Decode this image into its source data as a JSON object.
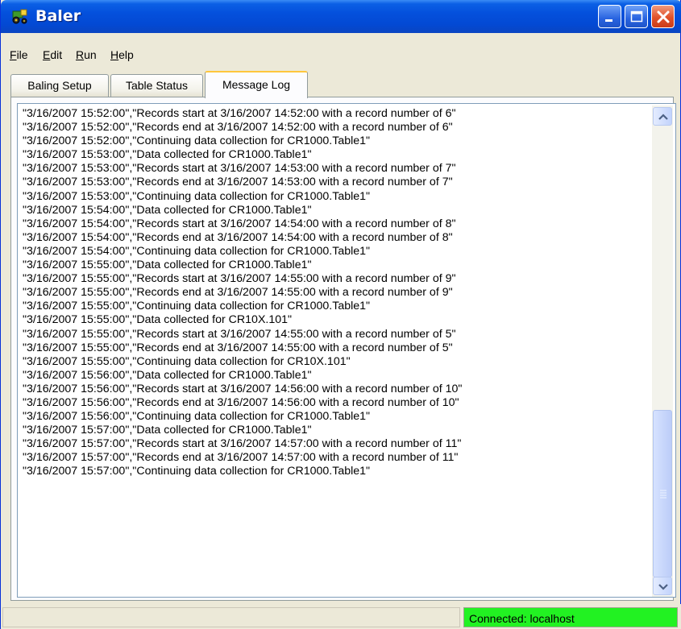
{
  "window": {
    "title": "Baler"
  },
  "menu": [
    {
      "label": "File",
      "mnemonic": "F",
      "rest": "ile"
    },
    {
      "label": "Edit",
      "mnemonic": "E",
      "rest": "dit"
    },
    {
      "label": "Run",
      "mnemonic": "R",
      "rest": "un"
    },
    {
      "label": "Help",
      "mnemonic": "H",
      "rest": "elp"
    }
  ],
  "tabs": [
    {
      "label": "Baling Setup",
      "active": false
    },
    {
      "label": "Table Status",
      "active": false
    },
    {
      "label": "Message Log",
      "active": true
    }
  ],
  "log": [
    "\"3/16/2007 15:52:00\",\"Records start at 3/16/2007 14:52:00 with a record number of 6\"",
    "\"3/16/2007 15:52:00\",\"Records end at 3/16/2007 14:52:00 with a record number of 6\"",
    "\"3/16/2007 15:52:00\",\"Continuing data collection for CR1000.Table1\"",
    "\"3/16/2007 15:53:00\",\"Data collected for CR1000.Table1\"",
    "\"3/16/2007 15:53:00\",\"Records start at 3/16/2007 14:53:00 with a record number of 7\"",
    "\"3/16/2007 15:53:00\",\"Records end at 3/16/2007 14:53:00 with a record number of 7\"",
    "\"3/16/2007 15:53:00\",\"Continuing data collection for CR1000.Table1\"",
    "\"3/16/2007 15:54:00\",\"Data collected for CR1000.Table1\"",
    "\"3/16/2007 15:54:00\",\"Records start at 3/16/2007 14:54:00 with a record number of 8\"",
    "\"3/16/2007 15:54:00\",\"Records end at 3/16/2007 14:54:00 with a record number of 8\"",
    "\"3/16/2007 15:54:00\",\"Continuing data collection for CR1000.Table1\"",
    "\"3/16/2007 15:55:00\",\"Data collected for CR1000.Table1\"",
    "\"3/16/2007 15:55:00\",\"Records start at 3/16/2007 14:55:00 with a record number of 9\"",
    "\"3/16/2007 15:55:00\",\"Records end at 3/16/2007 14:55:00 with a record number of 9\"",
    "\"3/16/2007 15:55:00\",\"Continuing data collection for CR1000.Table1\"",
    "\"3/16/2007 15:55:00\",\"Data collected for CR10X.101\"",
    "\"3/16/2007 15:55:00\",\"Records start at 3/16/2007 14:55:00 with a record number of 5\"",
    "\"3/16/2007 15:55:00\",\"Records end at 3/16/2007 14:55:00 with a record number of 5\"",
    "\"3/16/2007 15:55:00\",\"Continuing data collection for CR10X.101\"",
    "\"3/16/2007 15:56:00\",\"Data collected for CR1000.Table1\"",
    "\"3/16/2007 15:56:00\",\"Records start at 3/16/2007 14:56:00 with a record number of 10\"",
    "\"3/16/2007 15:56:00\",\"Records end at 3/16/2007 14:56:00 with a record number of 10\"",
    "\"3/16/2007 15:56:00\",\"Continuing data collection for CR1000.Table1\"",
    "\"3/16/2007 15:57:00\",\"Data collected for CR1000.Table1\"",
    "\"3/16/2007 15:57:00\",\"Records start at 3/16/2007 14:57:00 with a record number of 11\"",
    "\"3/16/2007 15:57:00\",\"Records end at 3/16/2007 14:57:00 with a record number of 11\"",
    "\"3/16/2007 15:57:00\",\"Continuing data collection for CR1000.Table1\""
  ],
  "status": {
    "connection": "Connected: localhost",
    "connection_color": "#22f222"
  },
  "colors": {
    "titlebar": "#0450dc",
    "close_button": "#e0512a",
    "active_tab_accent": "#ffc73c"
  },
  "icons": {
    "app": "baler-tractor-icon",
    "minimize": "minimize-icon",
    "maximize": "maximize-icon",
    "close": "close-icon",
    "scroll_up": "chevron-up-icon",
    "scroll_down": "chevron-down-icon"
  }
}
